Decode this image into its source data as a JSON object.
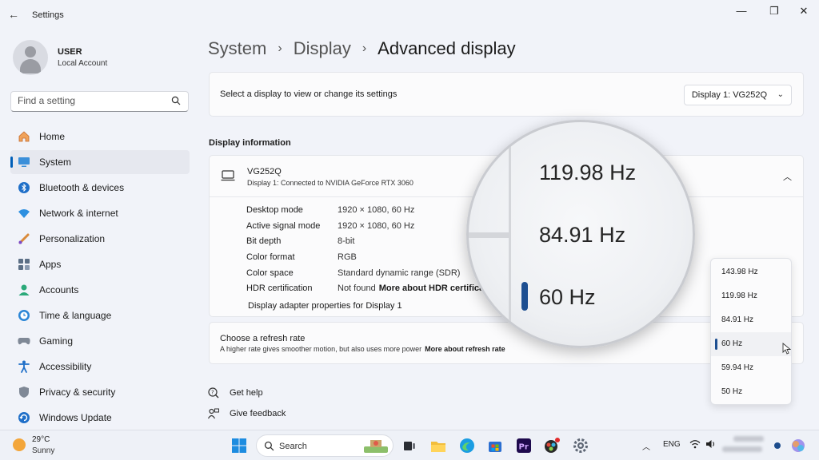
{
  "window": {
    "app_title": "Settings",
    "back": "←",
    "minimize": "—",
    "restore": "❐",
    "close": "✕"
  },
  "user": {
    "name": "USER",
    "account": "Local Account"
  },
  "search": {
    "placeholder": "Find a setting"
  },
  "nav": {
    "items": [
      {
        "label": "Home",
        "icon": "home-icon"
      },
      {
        "label": "System",
        "icon": "system-icon",
        "active": true
      },
      {
        "label": "Bluetooth & devices",
        "icon": "bluetooth-icon"
      },
      {
        "label": "Network & internet",
        "icon": "wifi-icon"
      },
      {
        "label": "Personalization",
        "icon": "brush-icon"
      },
      {
        "label": "Apps",
        "icon": "apps-icon"
      },
      {
        "label": "Accounts",
        "icon": "accounts-icon"
      },
      {
        "label": "Time & language",
        "icon": "globe-clock-icon"
      },
      {
        "label": "Gaming",
        "icon": "gamepad-icon"
      },
      {
        "label": "Accessibility",
        "icon": "accessibility-icon"
      },
      {
        "label": "Privacy & security",
        "icon": "shield-icon"
      },
      {
        "label": "Windows Update",
        "icon": "update-icon"
      }
    ]
  },
  "breadcrumb": {
    "item1": "System",
    "item2": "Display",
    "current": "Advanced display",
    "separator": "›"
  },
  "select_display": {
    "text": "Select a display to view or change its settings",
    "value": "Display 1: VG252Q"
  },
  "display_info": {
    "section_title": "Display information",
    "name": "VG252Q",
    "subtitle": "Display 1: Connected to NVIDIA GeForce RTX 3060",
    "rows": [
      {
        "key": "Desktop mode",
        "value": "1920 × 1080, 60 Hz"
      },
      {
        "key": "Active signal mode",
        "value": "1920 × 1080, 60 Hz"
      },
      {
        "key": "Bit depth",
        "value": "8-bit"
      },
      {
        "key": "Color format",
        "value": "RGB"
      },
      {
        "key": "Color space",
        "value": "Standard dynamic range (SDR)"
      },
      {
        "key": "HDR certification",
        "value": "Not found",
        "link": "More about HDR certifica"
      }
    ],
    "adapter_link": "Display adapter properties for Display 1"
  },
  "refresh": {
    "title": "Choose a refresh rate",
    "desc": "A higher rate gives smoother motion, but also uses more power",
    "more": "More about refresh rate",
    "options": [
      "143.98 Hz",
      "119.98 Hz",
      "84.91 Hz",
      "60 Hz",
      "59.94 Hz",
      "50 Hz"
    ],
    "selected": "60 Hz"
  },
  "magnifier": {
    "options": [
      "119.98 Hz",
      "84.91 Hz",
      "60 Hz"
    ]
  },
  "help": {
    "get_help": "Get help",
    "give_feedback": "Give feedback"
  },
  "taskbar": {
    "temperature": "29°C",
    "condition": "Sunny",
    "search_label": "Search",
    "lang": "ENG"
  },
  "colors": {
    "accent": "#005fb8",
    "selected_marker": "#1d4f91",
    "weather_sun": "#f3a63a"
  }
}
